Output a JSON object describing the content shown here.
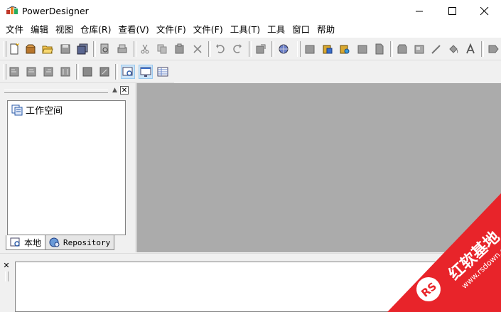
{
  "window": {
    "title": "PowerDesigner"
  },
  "menu": [
    "文件",
    "编辑",
    "视图",
    "仓库(R)",
    "查看(V)",
    "文件(F)",
    "文件(F)",
    "工具(T)",
    "工具",
    "窗口",
    "帮助"
  ],
  "left_pane": {
    "tree": {
      "workspace_label": "工作空间"
    },
    "tabs": {
      "local": "本地",
      "repository": "Repository"
    }
  },
  "watermark": {
    "brand": "红软基地",
    "url": "www.rsdown.cn",
    "color": "#e8242a"
  },
  "colors": {
    "workspace_bg": "#ababab",
    "chrome": "#f0f0f0"
  }
}
